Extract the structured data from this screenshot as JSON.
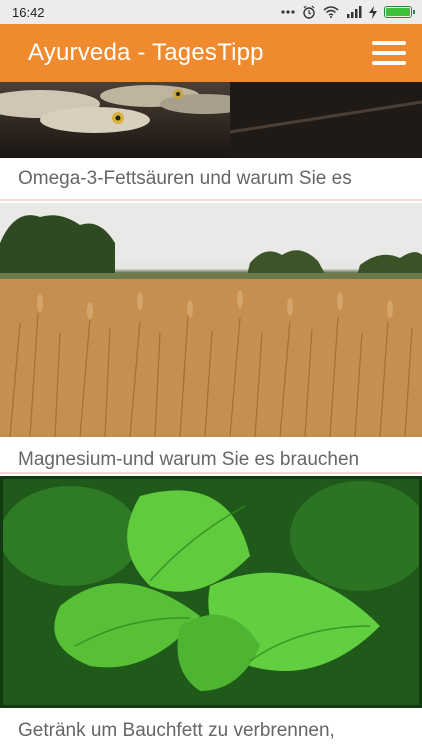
{
  "status_bar": {
    "time": "16:42",
    "icons": [
      "more-icon",
      "alarm-icon",
      "wifi-icon",
      "signal-icon",
      "charging-icon",
      "battery-icon"
    ],
    "battery_color": "#3cc13c"
  },
  "app_bar": {
    "title": "Ayurveda - TagesTipp",
    "background": "#f08a2e"
  },
  "feed": [
    {
      "title": "Omega-3-Fettsäuren und warum Sie es",
      "image": "fish"
    },
    {
      "title": "Magnesium-und warum Sie es brauchen",
      "image": "wheat-field"
    },
    {
      "title": "Getränk um Bauchfett zu verbrennen,",
      "image": "mint-leaves"
    }
  ]
}
